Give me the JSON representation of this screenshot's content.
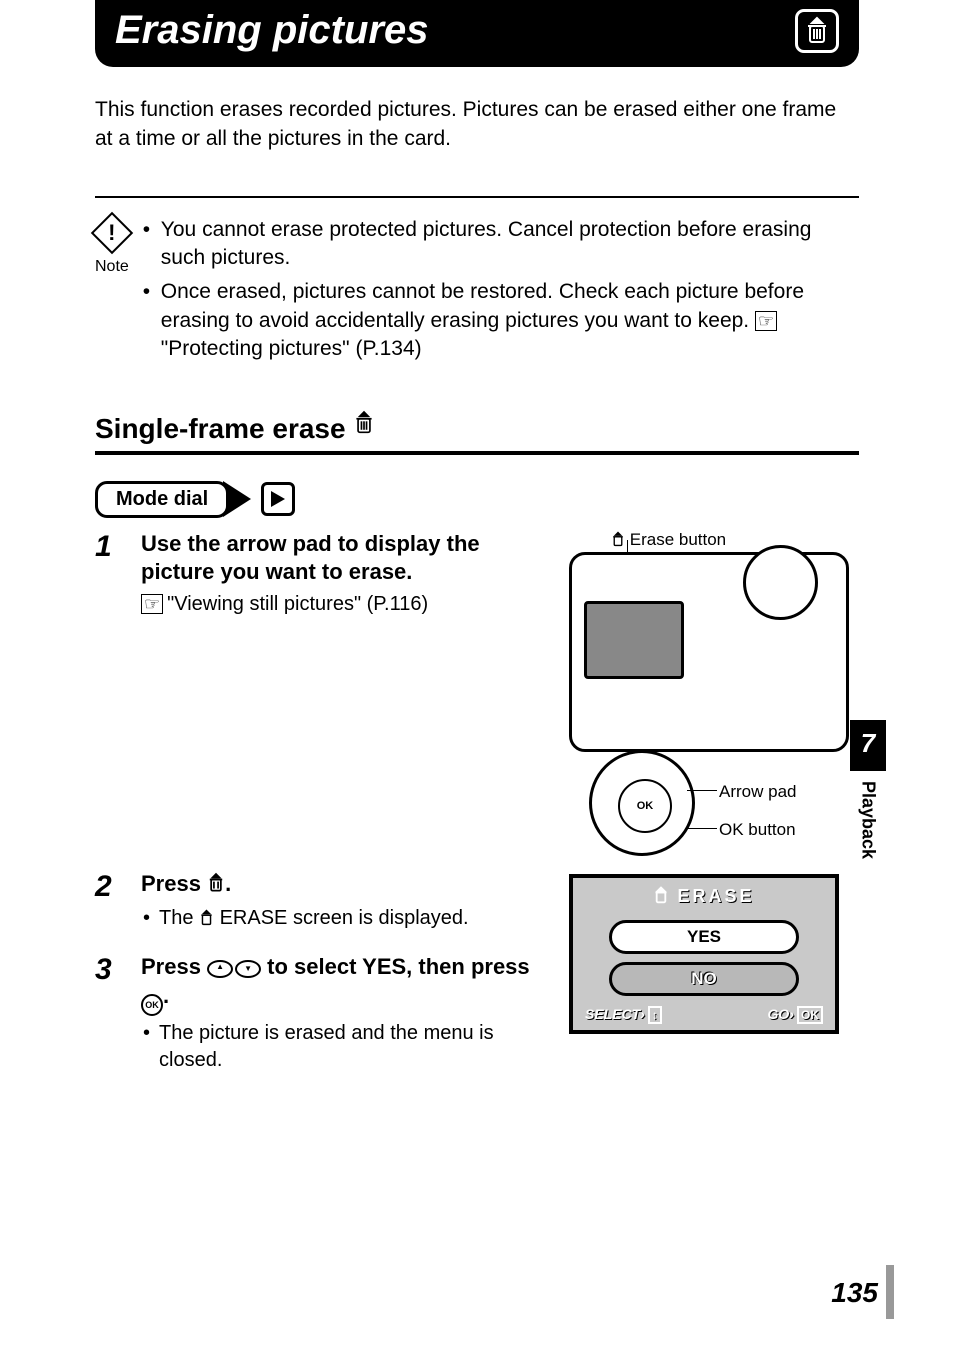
{
  "header": {
    "title": "Erasing pictures"
  },
  "intro": "This function erases recorded pictures. Pictures can be erased either one frame at a time or all the pictures in the card.",
  "note": {
    "label": "Note",
    "items": [
      "You cannot erase protected pictures. Cancel protection before erasing such pictures.",
      "Once erased, pictures cannot be restored. Check each picture before erasing to avoid accidentally erasing pictures you want to keep."
    ],
    "ref": "\"Protecting pictures\" (P.134)"
  },
  "subheading": "Single-frame erase",
  "mode_dial_label": "Mode dial",
  "steps": {
    "s1": {
      "num": "1",
      "title": "Use the arrow pad to display the picture you want to erase.",
      "ref": "\"Viewing still pictures\" (P.116)"
    },
    "s2": {
      "num": "2",
      "title_before": "Press ",
      "title_after": ".",
      "detail_before": "The ",
      "detail_after": " ERASE screen is displayed."
    },
    "s3": {
      "num": "3",
      "title_before": "Press ",
      "title_mid": " to select YES, then press ",
      "title_after": ".",
      "detail": "The picture is erased and the menu is closed."
    }
  },
  "diagram": {
    "erase_button": "Erase button",
    "arrow_pad": "Arrow pad",
    "ok_button": "OK button",
    "ok_text": "OK"
  },
  "erase_screen": {
    "title": "ERASE",
    "yes": "YES",
    "no": "NO",
    "select": "SELECT",
    "go": "GO",
    "ok": "OK"
  },
  "sidebar": {
    "chapter": "7",
    "name": "Playback"
  },
  "page_number": "135",
  "icons": {
    "reference": "☞",
    "erase_glyph": "🗑",
    "erase_glyph_white": "🗑"
  }
}
